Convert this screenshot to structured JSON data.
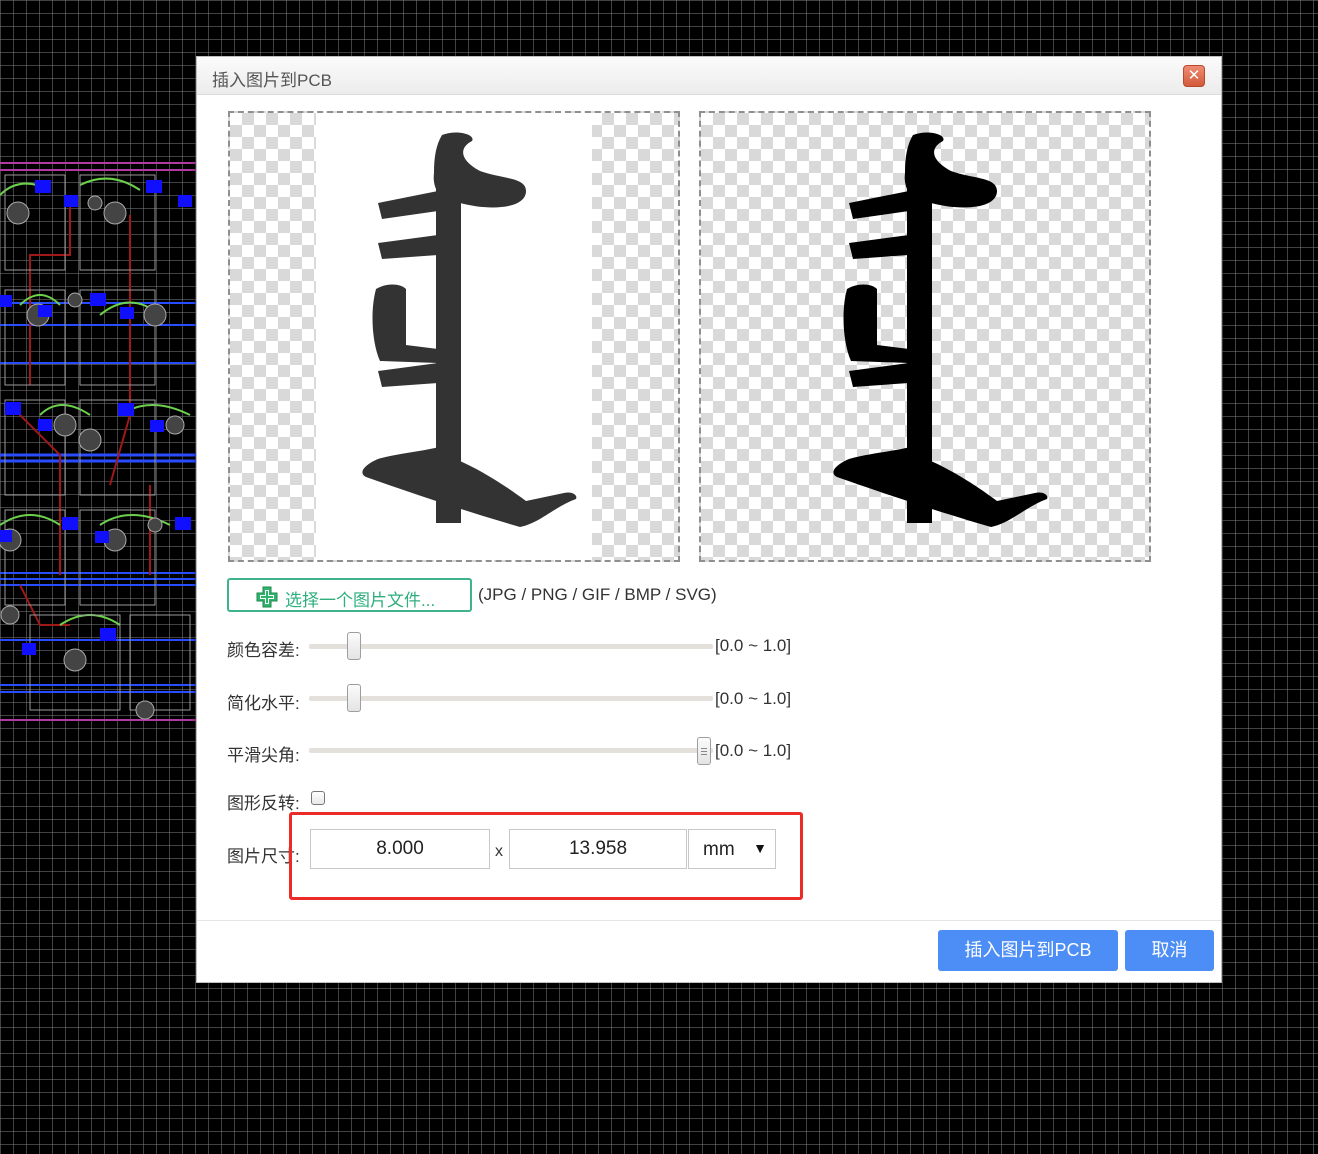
{
  "dialog": {
    "title": "插入图片到PCB",
    "close_label": "✕"
  },
  "file": {
    "choose_label": "选择一个图片文件...",
    "formats": "(JPG / PNG / GIF / BMP / SVG)"
  },
  "settings": {
    "color_tolerance": {
      "label": "颜色容差:",
      "range": "[0.0 ~ 1.0]",
      "value": 0.1
    },
    "simplify_level": {
      "label": "简化水平:",
      "range": "[0.0 ~ 1.0]",
      "value": 0.1
    },
    "smooth_corners": {
      "label": "平滑尖角:",
      "range": "[0.0 ~ 1.0]",
      "value": 1.0
    },
    "invert": {
      "label": "图形反转:",
      "checked": false
    },
    "size": {
      "label": "图片尺寸:",
      "width": "8.000",
      "separator": "x",
      "height": "13.958",
      "unit": "mm"
    }
  },
  "buttons": {
    "insert": "插入图片到PCB",
    "cancel": "取消"
  },
  "colors": {
    "accent_blue": "#4c8df6",
    "accent_green": "#2eaf7c",
    "highlight_red": "#ea2b27",
    "glyph_original": "#333333",
    "glyph_processed": "#000000"
  }
}
